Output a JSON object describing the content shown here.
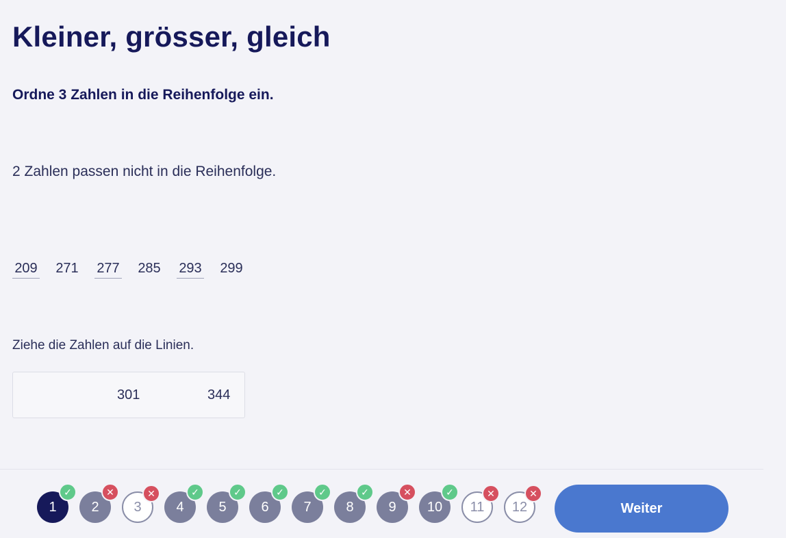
{
  "title": "Kleiner, grösser, gleich",
  "instruction": "Ordne 3 Zahlen in die Reihenfolge ein.",
  "note": "2 Zahlen passen nicht in die Reihenfolge.",
  "sequence": [
    {
      "value": "209",
      "underlined": true
    },
    {
      "value": "271",
      "underlined": false
    },
    {
      "value": "277",
      "underlined": true
    },
    {
      "value": "285",
      "underlined": false
    },
    {
      "value": "293",
      "underlined": true
    },
    {
      "value": "299",
      "underlined": false
    }
  ],
  "drag_hint": "Ziehe die Zahlen auf die Linien.",
  "drag_chips": [
    "301",
    "344"
  ],
  "progress": [
    {
      "label": "1",
      "state": "current",
      "result": "correct"
    },
    {
      "label": "2",
      "state": "done",
      "result": "wrong"
    },
    {
      "label": "3",
      "state": "open",
      "result": "wrong"
    },
    {
      "label": "4",
      "state": "done",
      "result": "correct"
    },
    {
      "label": "5",
      "state": "done",
      "result": "correct"
    },
    {
      "label": "6",
      "state": "done",
      "result": "correct"
    },
    {
      "label": "7",
      "state": "done",
      "result": "correct"
    },
    {
      "label": "8",
      "state": "done",
      "result": "correct"
    },
    {
      "label": "9",
      "state": "done",
      "result": "wrong"
    },
    {
      "label": "10",
      "state": "done",
      "result": "correct"
    },
    {
      "label": "11",
      "state": "open",
      "result": "wrong"
    },
    {
      "label": "12",
      "state": "open",
      "result": "wrong"
    }
  ],
  "next_label": "Weiter",
  "colors": {
    "title": "#16195a",
    "accent": "#4a78cf",
    "correct": "#5fc98a",
    "wrong": "#d6505f",
    "current_step": "#16195a",
    "done_step": "#7b7f9c"
  },
  "icons": {
    "correct": "check-icon",
    "wrong": "cross-icon"
  }
}
